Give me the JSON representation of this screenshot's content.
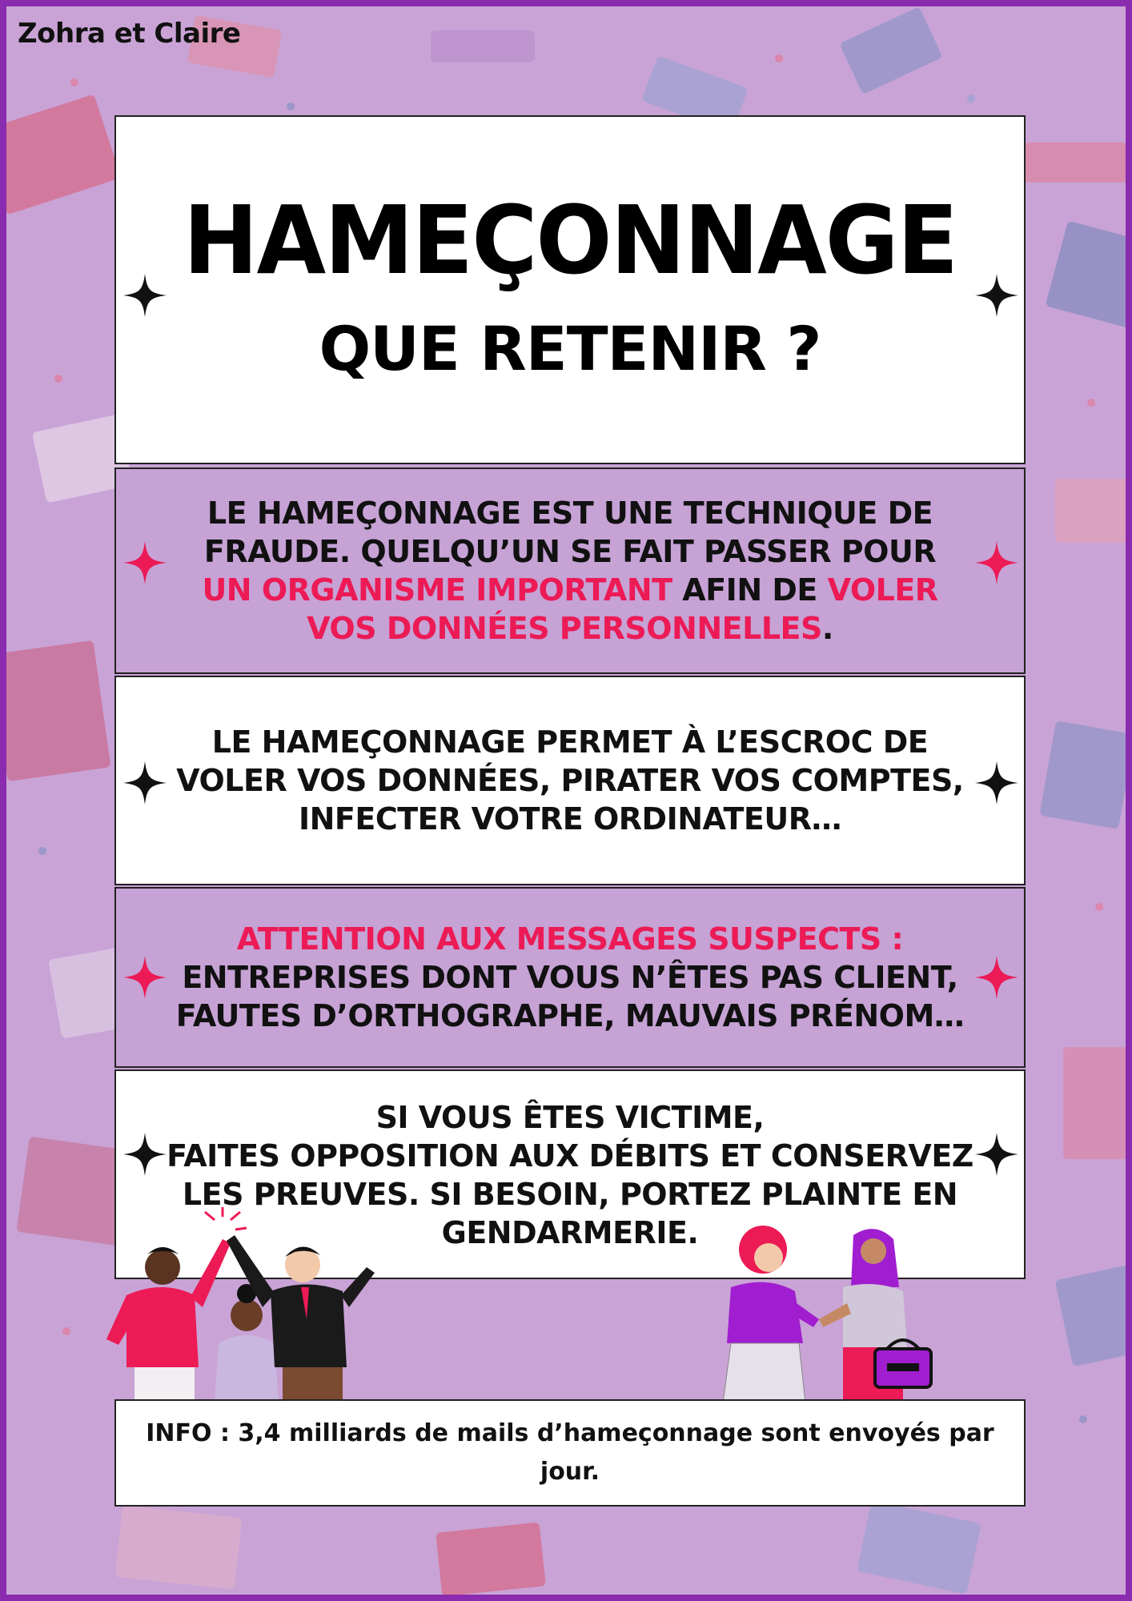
{
  "author": "Zohra et Claire",
  "title": "HAMEÇONNAGE",
  "subtitle": "QUE RETENIR ?",
  "section1": {
    "t1": "LE HAMEÇONNAGE EST UNE TECHNIQUE DE FRAUDE. QUELQU’UN SE FAIT PASSER POUR ",
    "h1": "UN ORGANISME IMPORTANT",
    "t2": " AFIN DE ",
    "h2": "VOLER VOS DONNÉES PERSONNELLES",
    "t3": "."
  },
  "section2": {
    "text": "LE HAMEÇONNAGE PERMET À L’ESCROC DE VOLER VOS DONNÉES, PIRATER VOS COMPTES, INFECTER VOTRE ORDINATEUR…"
  },
  "section3": {
    "heading": "ATTENTION AUX MESSAGES SUSPECTS :",
    "text": "ENTREPRISES DONT VOUS N’ÊTES PAS CLIENT, FAUTES D’ORTHOGRAPHE, MAUVAIS PRÉNOM…"
  },
  "section4": {
    "line1": "SI VOUS ÊTES VICTIME,",
    "line2": "FAITES OPPOSITION AUX DÉBITS ET CONSERVEZ LES PREUVES. SI BESOIN, PORTEZ PLAINTE EN GENDARMERIE."
  },
  "info": "INFO : 3,4 milliards de mails d’hameçonnage sont envoyés par jour.",
  "colors": {
    "background": "#c9a3d6",
    "border": "#8b2bb0",
    "accent": "#ec1a55",
    "panel_violet": "#c6a2d5"
  },
  "icons": [
    "sparkle-star-icon"
  ]
}
